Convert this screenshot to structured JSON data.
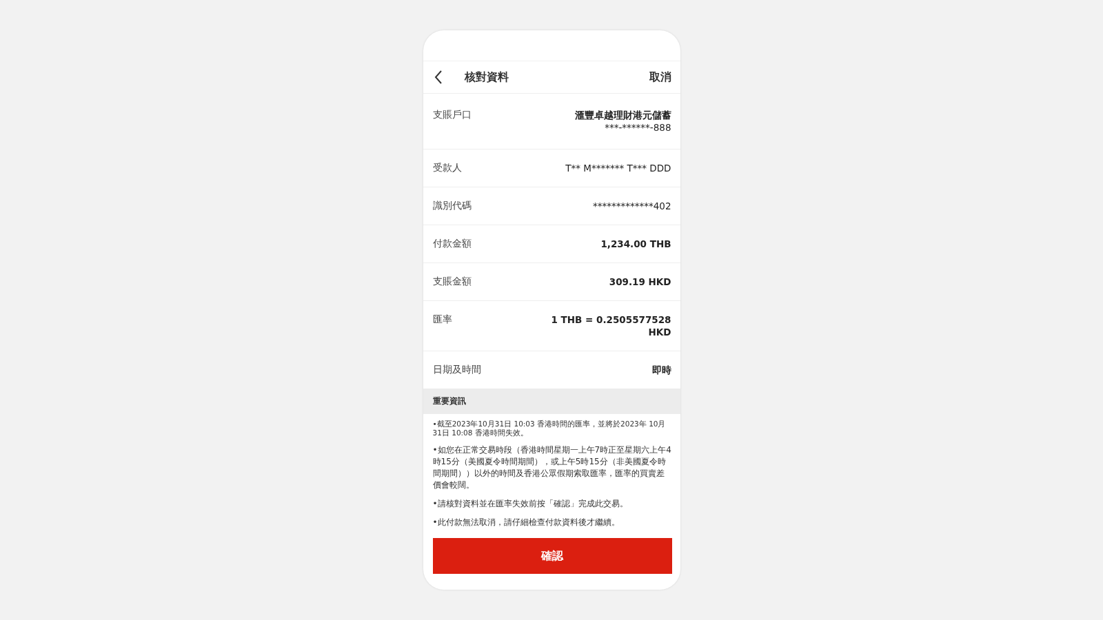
{
  "header": {
    "title": "核對資料",
    "cancel": "取消"
  },
  "rows": [
    {
      "label": "支賬戶口",
      "lines": [
        {
          "text": "滙豐卓越理財港元儲蓄",
          "bold": true
        },
        {
          "text": "***-******-888",
          "bold": false
        }
      ]
    },
    {
      "label": "受款人",
      "lines": [
        {
          "text": "T** M******* T*** DDD",
          "bold": false
        }
      ]
    },
    {
      "label": "識別代碼",
      "lines": [
        {
          "text": "*************402",
          "bold": false
        }
      ]
    },
    {
      "label": "付款金額",
      "lines": [
        {
          "text": "1,234.00 THB",
          "bold": true
        }
      ]
    },
    {
      "label": "支賬金額",
      "lines": [
        {
          "text": "309.19 HKD",
          "bold": true
        }
      ]
    },
    {
      "label": "匯率",
      "lines": [
        {
          "text": "1 THB = 0.2505577528",
          "bold": true
        },
        {
          "text": "HKD",
          "bold": true
        }
      ]
    },
    {
      "label": "日期及時間",
      "lines": [
        {
          "text": "即時",
          "bold": true
        }
      ]
    }
  ],
  "important": {
    "title": "重要資訊",
    "notes": [
      "•截至2023年10月31日 10:03 香港時間的匯率，並將於2023年 10月31日 10:08 香港時間失效。",
      "•如您在正常交易時段（香港時間星期一上午7時正至星期六上午4時15分（美國夏令時間期間），或上午5時15分（非美國夏令時間期間））以外的時間及香港公眾假期索取匯率，匯率的買賣差價會較闊。",
      "•請核對資料並在匯率失效前按「確認」完成此交易。",
      "•此付款無法取消，請仔細檢查付款資料後才繼續。"
    ]
  },
  "confirm": "確認"
}
